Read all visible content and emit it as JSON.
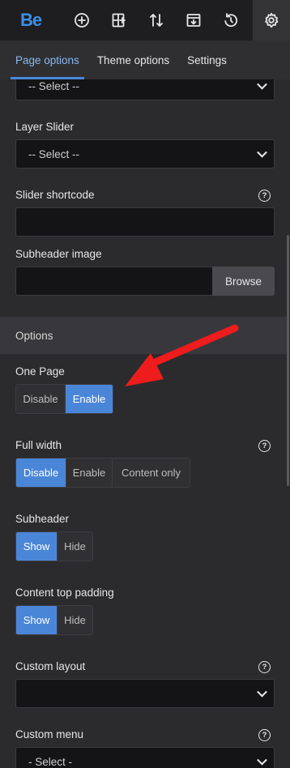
{
  "toolbar": {
    "logo": "Be",
    "icons": [
      "add-circle-icon",
      "add-section-icon",
      "sort-arrows-icon",
      "import-icon",
      "history-icon",
      "gear-icon"
    ]
  },
  "tabs": [
    {
      "label": "Page options",
      "active": true
    },
    {
      "label": "Theme options",
      "active": false
    },
    {
      "label": "Settings",
      "active": false
    }
  ],
  "fields": {
    "top_select_value": "-- Select --",
    "layer_slider": {
      "label": "Layer Slider",
      "value": "-- Select --"
    },
    "slider_shortcode": {
      "label": "Slider shortcode",
      "help": "?",
      "value": ""
    },
    "subheader_image": {
      "label": "Subheader image",
      "value": "",
      "browse": "Browse"
    }
  },
  "options_section": {
    "title": "Options",
    "one_page": {
      "label": "One Page",
      "options": [
        "Disable",
        "Enable"
      ],
      "selected": "Enable"
    },
    "full_width": {
      "label": "Full width",
      "help": "?",
      "options": [
        "Disable",
        "Enable",
        "Content only"
      ],
      "selected": "Disable"
    },
    "subheader": {
      "label": "Subheader",
      "options": [
        "Show",
        "Hide"
      ],
      "selected": "Show"
    },
    "content_top_padding": {
      "label": "Content top padding",
      "options": [
        "Show",
        "Hide"
      ],
      "selected": "Show"
    },
    "custom_layout": {
      "label": "Custom layout",
      "help": "?",
      "value": ""
    },
    "custom_menu": {
      "label": "Custom menu",
      "help": "?",
      "value": "- Select -"
    }
  },
  "colors": {
    "accent": "#4a86d8",
    "annotation_arrow": "#ee1c1c"
  }
}
